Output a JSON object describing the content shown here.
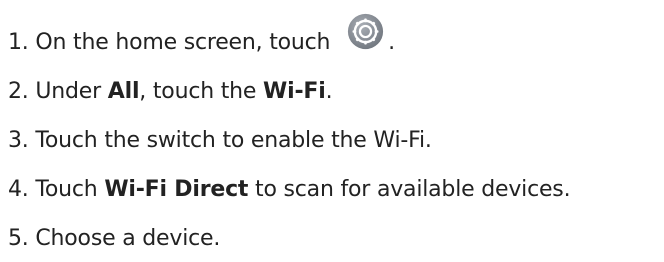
{
  "steps": [
    {
      "number": "1.",
      "text_before": "On the home screen, touch",
      "icon": "settings-gear-icon",
      "text_after": "."
    },
    {
      "number": "2.",
      "text_before": "Under",
      "bold_1": "All",
      "text_middle": ", touch the",
      "bold_2": "Wi-Fi",
      "text_after": "."
    },
    {
      "number": "3.",
      "text": "Touch the switch to enable the Wi-Fi."
    },
    {
      "number": "4.",
      "text_before": "Touch",
      "bold": "Wi-Fi Direct",
      "text_after": "to scan for available devices."
    },
    {
      "number": "5.",
      "text": "Choose a device."
    }
  ],
  "colors": {
    "text": "#222222",
    "icon_bg": "#8a8f96",
    "icon_fg": "#ffffff"
  }
}
